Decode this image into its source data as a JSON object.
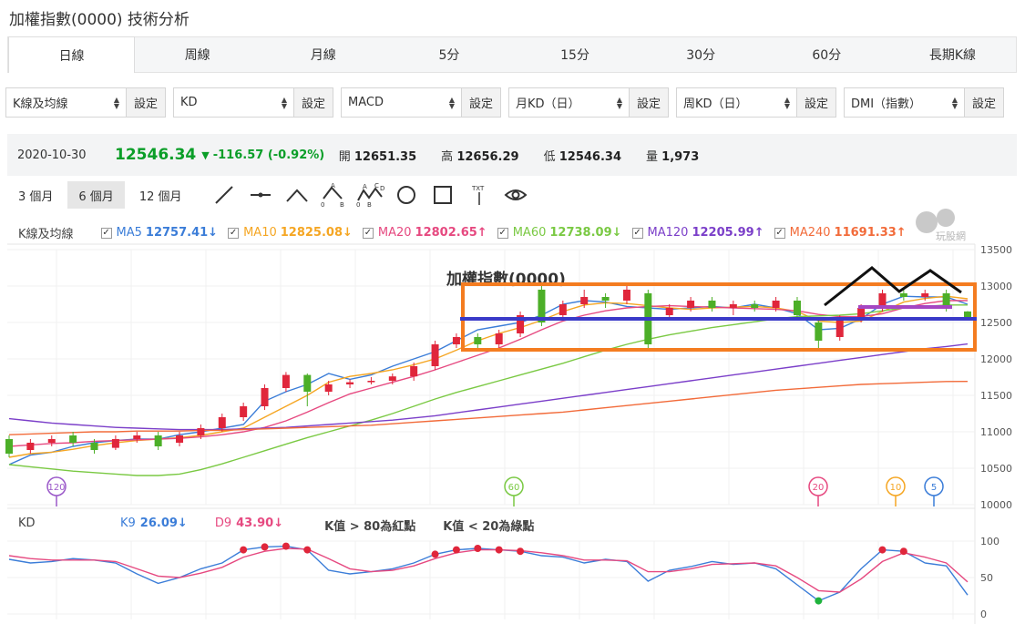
{
  "title": "加權指數(0000) 技術分析",
  "tabs": [
    "日線",
    "周線",
    "月線",
    "5分",
    "15分",
    "30分",
    "60分",
    "長期K線"
  ],
  "selectors": [
    {
      "value": "K線及均線",
      "button": "設定"
    },
    {
      "value": "KD",
      "button": "設定"
    },
    {
      "value": "MACD",
      "button": "設定"
    },
    {
      "value": "月KD（日）",
      "button": "設定"
    },
    {
      "value": "周KD（日）",
      "button": "設定"
    },
    {
      "value": "DMI（指數）",
      "button": "設定"
    }
  ],
  "quote": {
    "date": "2020-10-30",
    "price": "12546.34",
    "change": "-116.57 (-0.92%)",
    "open_label": "開",
    "open": "12651.35",
    "high_label": "高",
    "high": "12656.29",
    "low_label": "低",
    "low": "12546.34",
    "vol_label": "量",
    "vol": "1,973"
  },
  "ranges": [
    "3 個月",
    "6 個月",
    "12 個月"
  ],
  "tools": [
    "line-tool-icon",
    "segment-tool-icon",
    "wedge-tool-icon",
    "abc-pattern-icon",
    "abcd-pattern-icon",
    "circle-tool-icon",
    "rect-tool-icon",
    "text-tool-icon",
    "eye-icon"
  ],
  "tool_text": {
    "txt": "TXT",
    "a": "A",
    "b": "B",
    "c": "C",
    "d": "D",
    "zero": "0"
  },
  "ma_title": "K線及均線",
  "ma": [
    {
      "name": "MA5",
      "value": "12757.41↓",
      "color": "#3b7dd8"
    },
    {
      "name": "MA10",
      "value": "12825.08↓",
      "color": "#f5a623"
    },
    {
      "name": "MA20",
      "value": "12802.65↑",
      "color": "#e64980"
    },
    {
      "name": "MA60",
      "value": "12738.09↓",
      "color": "#7ac943"
    },
    {
      "name": "MA120",
      "value": "12205.99↑",
      "color": "#7b3fc9"
    },
    {
      "name": "MA240",
      "value": "11691.33↑",
      "color": "#f26b3a"
    }
  ],
  "kd": {
    "title": "KD",
    "k_label": "K9",
    "k_value": "26.09↓",
    "d_label": "D9",
    "d_value": "43.90↓",
    "note1": "K值 > 80為紅點",
    "note2": "K值 < 20為綠點"
  },
  "watermark": "玩股網",
  "chart_annotation": "加權指數(0000)",
  "chart_data": {
    "type": "line",
    "main": {
      "yticks": [
        13500,
        13000,
        12500,
        12000,
        11500,
        11000,
        10500,
        10000
      ],
      "ylim": [
        10000,
        13500
      ],
      "ma_markers": [
        {
          "label": "120",
          "color": "#9b59c9"
        },
        {
          "label": "60",
          "color": "#7ac943"
        },
        {
          "label": "20",
          "color": "#e64980"
        },
        {
          "label": "10",
          "color": "#f5a623"
        },
        {
          "label": "5",
          "color": "#3b7dd8"
        }
      ],
      "series": [
        {
          "name": "MA5",
          "color": "#3b7dd8",
          "values": [
            10550,
            10680,
            10720,
            10800,
            10850,
            10880,
            10900,
            10900,
            10960,
            11000,
            11050,
            11100,
            11420,
            11550,
            11650,
            11800,
            11720,
            11780,
            11900,
            12000,
            12100,
            12250,
            12400,
            12450,
            12500,
            12600,
            12750,
            12800,
            12780,
            12720,
            12700,
            12680,
            12700,
            12720,
            12700,
            12750,
            12700,
            12620,
            12400,
            12420,
            12550,
            12750,
            12860,
            12850,
            12850,
            12750
          ]
        },
        {
          "name": "MA10",
          "color": "#f5a623",
          "values": [
            10650,
            10700,
            10720,
            10760,
            10810,
            10850,
            10880,
            10900,
            10920,
            10950,
            11000,
            11050,
            11200,
            11350,
            11500,
            11680,
            11760,
            11800,
            11850,
            11920,
            12000,
            12120,
            12250,
            12350,
            12430,
            12530,
            12650,
            12740,
            12770,
            12760,
            12730,
            12700,
            12680,
            12700,
            12710,
            12720,
            12700,
            12650,
            12520,
            12500,
            12520,
            12650,
            12780,
            12830,
            12860,
            12825
          ]
        },
        {
          "name": "MA20",
          "color": "#e64980",
          "values": [
            10800,
            10820,
            10840,
            10850,
            10870,
            10880,
            10890,
            10900,
            10910,
            10930,
            10960,
            11000,
            11060,
            11150,
            11270,
            11400,
            11520,
            11600,
            11680,
            11760,
            11850,
            11950,
            12050,
            12150,
            12270,
            12400,
            12520,
            12600,
            12660,
            12700,
            12720,
            12730,
            12720,
            12710,
            12700,
            12690,
            12680,
            12660,
            12610,
            12580,
            12580,
            12620,
            12700,
            12760,
            12800,
            12800
          ]
        },
        {
          "name": "MA60",
          "color": "#7ac943",
          "values": [
            10550,
            10520,
            10490,
            10460,
            10440,
            10420,
            10400,
            10400,
            10420,
            10480,
            10560,
            10650,
            10740,
            10830,
            10920,
            11000,
            11080,
            11160,
            11250,
            11350,
            11450,
            11540,
            11620,
            11700,
            11780,
            11860,
            11940,
            12030,
            12120,
            12200,
            12270,
            12330,
            12380,
            12430,
            12470,
            12510,
            12550,
            12580,
            12590,
            12600,
            12620,
            12660,
            12700,
            12720,
            12740,
            12740
          ]
        },
        {
          "name": "MA120",
          "color": "#7b3fc9",
          "values": [
            11180,
            11150,
            11120,
            11100,
            11080,
            11060,
            11050,
            11040,
            11030,
            11030,
            11030,
            11040,
            11050,
            11060,
            11080,
            11100,
            11120,
            11140,
            11160,
            11190,
            11220,
            11260,
            11300,
            11340,
            11380,
            11420,
            11460,
            11500,
            11540,
            11580,
            11620,
            11660,
            11700,
            11740,
            11780,
            11820,
            11860,
            11900,
            11940,
            11980,
            12020,
            12060,
            12100,
            12140,
            12170,
            12205
          ]
        },
        {
          "name": "MA240",
          "color": "#f26b3a",
          "values": [
            10960,
            10970,
            10980,
            10990,
            11000,
            11000,
            11010,
            11010,
            11010,
            11020,
            11020,
            11030,
            11040,
            11050,
            11060,
            11070,
            11080,
            11090,
            11110,
            11130,
            11150,
            11170,
            11190,
            11210,
            11230,
            11250,
            11270,
            11300,
            11330,
            11360,
            11390,
            11420,
            11450,
            11480,
            11510,
            11540,
            11570,
            11590,
            11610,
            11630,
            11650,
            11660,
            11670,
            11680,
            11690,
            11691
          ]
        }
      ],
      "candles": [
        {
          "o": 10900,
          "c": 10700,
          "h": 10950,
          "l": 10650
        },
        {
          "o": 10750,
          "c": 10850,
          "h": 10900,
          "l": 10700
        },
        {
          "o": 10850,
          "c": 10900,
          "h": 10950,
          "l": 10800
        },
        {
          "o": 10950,
          "c": 10850,
          "h": 11000,
          "l": 10800
        },
        {
          "o": 10850,
          "c": 10750,
          "h": 10900,
          "l": 10700
        },
        {
          "o": 10780,
          "c": 10900,
          "h": 10950,
          "l": 10750
        },
        {
          "o": 10900,
          "c": 10950,
          "h": 11000,
          "l": 10850
        },
        {
          "o": 10950,
          "c": 10800,
          "h": 11000,
          "l": 10750
        },
        {
          "o": 10850,
          "c": 10950,
          "h": 11000,
          "l": 10800
        },
        {
          "o": 10950,
          "c": 11050,
          "h": 11100,
          "l": 10900
        },
        {
          "o": 11050,
          "c": 11200,
          "h": 11250,
          "l": 11000
        },
        {
          "o": 11200,
          "c": 11350,
          "h": 11400,
          "l": 11150
        },
        {
          "o": 11350,
          "c": 11600,
          "h": 11650,
          "l": 11300
        },
        {
          "o": 11600,
          "c": 11780,
          "h": 11820,
          "l": 11550
        },
        {
          "o": 11780,
          "c": 11550,
          "h": 11800,
          "l": 11350
        },
        {
          "o": 11550,
          "c": 11650,
          "h": 11700,
          "l": 11500
        },
        {
          "o": 11650,
          "c": 11680,
          "h": 11720,
          "l": 11600
        },
        {
          "o": 11680,
          "c": 11700,
          "h": 11750,
          "l": 11650
        },
        {
          "o": 11700,
          "c": 11760,
          "h": 11800,
          "l": 11650
        },
        {
          "o": 11760,
          "c": 11900,
          "h": 11950,
          "l": 11700
        },
        {
          "o": 11900,
          "c": 12200,
          "h": 12250,
          "l": 11850
        },
        {
          "o": 12200,
          "c": 12300,
          "h": 12350,
          "l": 12150
        },
        {
          "o": 12300,
          "c": 12200,
          "h": 12350,
          "l": 12150
        },
        {
          "o": 12200,
          "c": 12350,
          "h": 12400,
          "l": 12150
        },
        {
          "o": 12350,
          "c": 12600,
          "h": 12650,
          "l": 12300
        },
        {
          "o": 12950,
          "c": 12500,
          "h": 13000,
          "l": 12450
        },
        {
          "o": 12600,
          "c": 12750,
          "h": 12800,
          "l": 12550
        },
        {
          "o": 12750,
          "c": 12850,
          "h": 12950,
          "l": 12700
        },
        {
          "o": 12850,
          "c": 12800,
          "h": 12900,
          "l": 12700
        },
        {
          "o": 12800,
          "c": 12950,
          "h": 13000,
          "l": 12750
        },
        {
          "o": 12900,
          "c": 12200,
          "h": 12950,
          "l": 12150
        },
        {
          "o": 12600,
          "c": 12700,
          "h": 12750,
          "l": 12550
        },
        {
          "o": 12700,
          "c": 12800,
          "h": 12850,
          "l": 12650
        },
        {
          "o": 12800,
          "c": 12700,
          "h": 12850,
          "l": 12650
        },
        {
          "o": 12700,
          "c": 12750,
          "h": 12800,
          "l": 12600
        },
        {
          "o": 12750,
          "c": 12700,
          "h": 12800,
          "l": 12650
        },
        {
          "o": 12700,
          "c": 12800,
          "h": 12850,
          "l": 12650
        },
        {
          "o": 12800,
          "c": 12600,
          "h": 12850,
          "l": 12550
        },
        {
          "o": 12500,
          "c": 12250,
          "h": 12550,
          "l": 12150
        },
        {
          "o": 12300,
          "c": 12550,
          "h": 12600,
          "l": 12250
        },
        {
          "o": 12550,
          "c": 12700,
          "h": 12750,
          "l": 12500
        },
        {
          "o": 12700,
          "c": 12900,
          "h": 12950,
          "l": 12650
        },
        {
          "o": 12900,
          "c": 12850,
          "h": 12950,
          "l": 12800
        },
        {
          "o": 12850,
          "c": 12900,
          "h": 12950,
          "l": 12800
        },
        {
          "o": 12900,
          "c": 12700,
          "h": 12950,
          "l": 12650
        },
        {
          "o": 12651,
          "c": 12546,
          "h": 12656,
          "l": 12546
        }
      ]
    },
    "kd": {
      "yticks": [
        100,
        50,
        0
      ],
      "ylim": [
        0,
        100
      ],
      "series": [
        {
          "name": "K9",
          "color": "#3b7dd8",
          "values": [
            75,
            70,
            72,
            76,
            74,
            70,
            55,
            42,
            50,
            62,
            70,
            88,
            92,
            93,
            88,
            60,
            55,
            58,
            62,
            70,
            82,
            88,
            90,
            88,
            86,
            80,
            78,
            70,
            75,
            72,
            45,
            60,
            65,
            72,
            68,
            70,
            62,
            40,
            18,
            30,
            62,
            88,
            86,
            70,
            66,
            26
          ]
        },
        {
          "name": "D9",
          "color": "#e64980",
          "values": [
            80,
            76,
            74,
            74,
            74,
            72,
            62,
            52,
            50,
            56,
            64,
            78,
            86,
            90,
            89,
            76,
            62,
            58,
            60,
            66,
            76,
            84,
            88,
            88,
            87,
            84,
            80,
            74,
            74,
            73,
            58,
            58,
            62,
            68,
            69,
            70,
            66,
            50,
            32,
            30,
            48,
            72,
            84,
            78,
            70,
            44
          ]
        }
      ]
    }
  }
}
